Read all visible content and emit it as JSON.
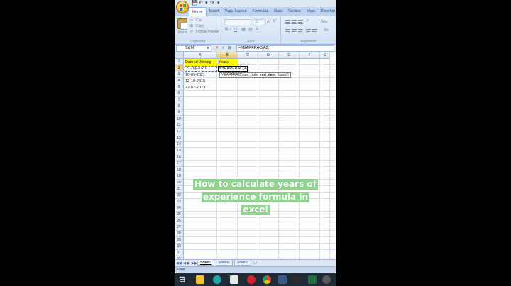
{
  "ribbon": {
    "tabs": [
      "Home",
      "Insert",
      "Page Layout",
      "Formulas",
      "Data",
      "Review",
      "View",
      "Develop"
    ],
    "clipboard": {
      "paste_label": "Paste",
      "cut_label": "Cut",
      "copy_label": "Copy",
      "format_painter_label": "Format Painter",
      "group_label": "Clipboard"
    },
    "font": {
      "size_value": "11",
      "group_label": "Font"
    },
    "alignment": {
      "wrap_label": "Wra",
      "merge_label": "Me",
      "group_label": "Alignment"
    }
  },
  "formula_bar": {
    "name_box": "SUM",
    "fx_label": "fx",
    "formula": "=YEARFRAC(A2,"
  },
  "columns": [
    "A",
    "B",
    "C",
    "D",
    "E",
    "F",
    "G"
  ],
  "rows": [
    "1",
    "2",
    "3",
    "4",
    "5",
    "6",
    "7",
    "8",
    "9",
    "10",
    "11",
    "12",
    "13",
    "14",
    "15",
    "16",
    "17",
    "18",
    "19",
    "20",
    "21",
    "22",
    "23",
    "24",
    "25",
    "26",
    "27",
    "28",
    "29",
    "30",
    "31",
    "32"
  ],
  "cells": {
    "a1": "Date of Joining",
    "b1": "Years",
    "a2": "21-09-2020",
    "b2": "=YEARFRAC(A2,",
    "a3": "10-09-2021",
    "a4": "12-10-2015",
    "a5": "22-02-2023"
  },
  "tooltip": {
    "pre": "YEARFRAC(start_date, ",
    "bold": "end_date",
    "post": ", [basis])"
  },
  "caption": {
    "line1": "How to calculate years of",
    "line2": "experience formula in",
    "line3": "excel"
  },
  "sheets": [
    "Sheet1",
    "Sheet2",
    "Sheet3"
  ],
  "status": "Enter"
}
